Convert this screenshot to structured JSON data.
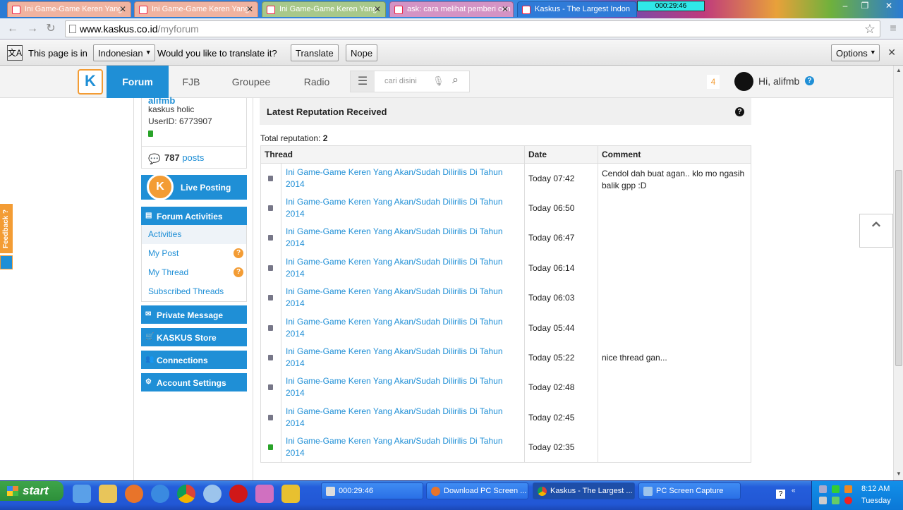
{
  "browser": {
    "tabs": [
      {
        "title": "Ini Game-Game Keren Yang",
        "active": false
      },
      {
        "title": "Ini Game-Game Keren Yang",
        "active": false
      },
      {
        "title": "Ini Game-Game Keren Yang",
        "active": false
      },
      {
        "title": "ask: cara melihat pemberi cen",
        "active": false
      },
      {
        "title": "Kaskus - The Largest Indon",
        "active": true
      }
    ],
    "timer": "000:29:46",
    "url_host": "www.kaskus.co.id",
    "url_path": "/myforum"
  },
  "translate_bar": {
    "prefix": "This page is in",
    "language": "Indonesian",
    "question": "Would you like to translate it?",
    "translate_label": "Translate",
    "nope_label": "Nope",
    "options_label": "Options"
  },
  "header": {
    "nav": [
      {
        "label": "Forum",
        "active": true
      },
      {
        "label": "FJB",
        "active": false
      },
      {
        "label": "Groupee",
        "active": false
      },
      {
        "label": "Radio",
        "active": false
      }
    ],
    "search_placeholder": "cari disini",
    "notification_count": "4",
    "greeting": "Hi, alifmb"
  },
  "profile": {
    "username": "alifmb",
    "rank": "kaskus holic",
    "userid": "UserID: 6773907",
    "post_count": "787",
    "post_label": "posts"
  },
  "sidebar": {
    "live_posting": "Live Posting",
    "forum_activities": "Forum Activities",
    "items": [
      "Activities",
      "My Post",
      "My Thread",
      "Subscribed Threads"
    ],
    "private_message": "Private Message",
    "store": "KASKUS Store",
    "connections": "Connections",
    "account_settings": "Account Settings"
  },
  "feedback_label": "Feedback ?",
  "reputation": {
    "title": "Latest Reputation Received",
    "total_label": "Total reputation:",
    "total_value": "2",
    "columns": [
      "Thread",
      "Date",
      "Comment"
    ],
    "rows": [
      {
        "thread": "Ini Game-Game Keren Yang Akan/Sudah Dilirilis Di Tahun 2014",
        "date": "Today 07:42",
        "comment": "Cendol dah buat agan.. klo mo ngasih balik gpp :D",
        "positive": false
      },
      {
        "thread": "Ini Game-Game Keren Yang Akan/Sudah Dilirilis Di Tahun 2014",
        "date": "Today 06:50",
        "comment": "",
        "positive": false
      },
      {
        "thread": "Ini Game-Game Keren Yang Akan/Sudah Dilirilis Di Tahun 2014",
        "date": "Today 06:47",
        "comment": "",
        "positive": false
      },
      {
        "thread": "Ini Game-Game Keren Yang Akan/Sudah Dilirilis Di Tahun 2014",
        "date": "Today 06:14",
        "comment": "",
        "positive": false
      },
      {
        "thread": "Ini Game-Game Keren Yang Akan/Sudah Dilirilis Di Tahun 2014",
        "date": "Today 06:03",
        "comment": "",
        "positive": false
      },
      {
        "thread": "Ini Game-Game Keren Yang Akan/Sudah Dilirilis Di Tahun 2014",
        "date": "Today 05:44",
        "comment": "",
        "positive": false
      },
      {
        "thread": "Ini Game-Game Keren Yang Akan/Sudah Dilirilis Di Tahun 2014",
        "date": "Today 05:22",
        "comment": "nice thread gan...",
        "positive": false
      },
      {
        "thread": "Ini Game-Game Keren Yang Akan/Sudah Dilirilis Di Tahun 2014",
        "date": "Today 02:48",
        "comment": "",
        "positive": false
      },
      {
        "thread": "Ini Game-Game Keren Yang Akan/Sudah Dilirilis Di Tahun 2014",
        "date": "Today 02:45",
        "comment": "",
        "positive": false
      },
      {
        "thread": "Ini Game-Game Keren Yang Akan/Sudah Dilirilis Di Tahun 2014",
        "date": "Today 02:35",
        "comment": "",
        "positive": true
      }
    ]
  },
  "taskbar": {
    "start_label": "start",
    "tasks": [
      {
        "label": "000:29:46",
        "active": false
      },
      {
        "label": "Download PC Screen ...",
        "active": false
      },
      {
        "label": "Kaskus - The Largest ...",
        "active": true
      },
      {
        "label": "PC Screen Capture",
        "active": false
      }
    ],
    "time": "8:12 AM",
    "day": "Tuesday"
  },
  "colors": {
    "kaskus_blue": "#1f8fd6",
    "kaskus_orange": "#f39c34",
    "xp_taskbar": "#245edb"
  }
}
